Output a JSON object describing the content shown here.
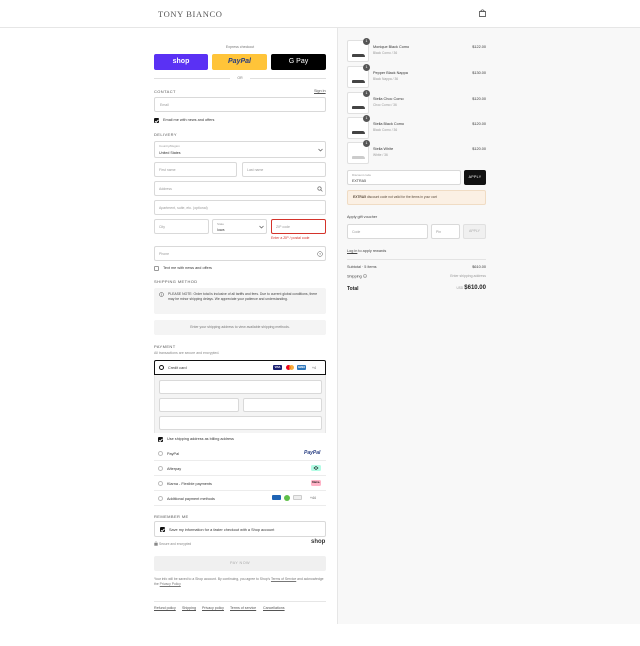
{
  "header": {
    "brand": "TONY BIANCO"
  },
  "express": {
    "label": "Express checkout",
    "shop_label": "shop",
    "paypal_label": "PayPal",
    "gpay_label": "G Pay",
    "or_label": "OR"
  },
  "contact": {
    "heading": "CONTACT",
    "signin": "Sign in",
    "email_placeholder": "Email",
    "email_news": "Email me with news and offers"
  },
  "delivery": {
    "heading": "DELIVERY",
    "country_label": "Country/Region",
    "country_value": "United States",
    "first_name": "First name",
    "last_name": "Last name",
    "address": "Address",
    "apartment": "Apartment, suite, etc. (optional)",
    "city": "City",
    "state_label": "State",
    "state_value": "Iowa",
    "zip": "ZIP code",
    "zip_error": "Enter a ZIP / postal code",
    "phone": "Phone",
    "text_news": "Text me with news and offers"
  },
  "shipping": {
    "heading": "SHIPPING METHOD",
    "note": "PLEASE NOTE: Order total is inclusive of all tariffs and fees. Due to current global conditions, there may be minor shipping delays. We appreciate your patience and understanding.",
    "placeholder": "Enter your shipping address to view available shipping methods."
  },
  "payment": {
    "heading": "PAYMENT",
    "sub": "All transactions are secure and encrypted.",
    "credit_card": "Credit card",
    "more_cards": "+4",
    "use_shipping": "Use shipping address as billing address",
    "paypal": "PayPal",
    "paypal_logo": "PayPal",
    "afterpay": "Afterpay",
    "klarna": "Klarna - Flexible payments",
    "klarna_logo": "Klarna.",
    "additional": "Additional payment methods",
    "additional_more": "+44"
  },
  "remember": {
    "heading": "REMEMBER ME",
    "save_info": "Save my information for a faster checkout with a Shop account",
    "secure": "Secure and encrypted",
    "shop_logo": "shop"
  },
  "pay_now": "PAY NOW",
  "legal": {
    "text_pre": "Your info will be saved to a Shop account. By continuing, you agree to Shop's",
    "terms": "Terms of Service",
    "text_mid": "and acknowledge the",
    "privacy": "Privacy Policy"
  },
  "footer": [
    "Refund policy",
    "Shipping",
    "Privacy policy",
    "Terms of service",
    "Cancellations"
  ],
  "cart": {
    "items": [
      {
        "name": "Monique Black Como",
        "variant": "Black Como / 36",
        "price": "$122.00",
        "qty": "1"
      },
      {
        "name": "Pepper Black Nappa",
        "variant": "Black Nappa / 36",
        "price": "$130.00",
        "qty": "1"
      },
      {
        "name": "Stella Choc Como",
        "variant": "Choc Como / 36",
        "price": "$120.00",
        "qty": "1"
      },
      {
        "name": "Stella Black Como",
        "variant": "Black Como / 36",
        "price": "$120.00",
        "qty": "1"
      },
      {
        "name": "Stella White",
        "variant": "White / 36",
        "price": "$120.00",
        "qty": "1"
      }
    ],
    "discount_label": "Discount code",
    "discount_value": "EXTRA5",
    "apply": "APPLY",
    "discount_note_code": "EXTRA5",
    "discount_note": "discount code not valid for the items in your cart",
    "gift_heading": "Apply gift voucher",
    "gift_code": "Code",
    "gift_pin": "Pin",
    "gift_apply": "APPLY",
    "login": "Log in",
    "login_rest": "to apply rewards",
    "subtotal_label": "Subtotal · 5 items",
    "subtotal": "$610.00",
    "shipping_label": "Shipping",
    "shipping_value": "Enter shipping address",
    "total_label": "Total",
    "currency": "USD",
    "total": "$610.00"
  },
  "colors": {
    "shop": "#5a31f4",
    "paypal": "#ffc439",
    "gpay": "#000000",
    "error": "#d4332b",
    "discount_bg": "#fbf0e4"
  }
}
